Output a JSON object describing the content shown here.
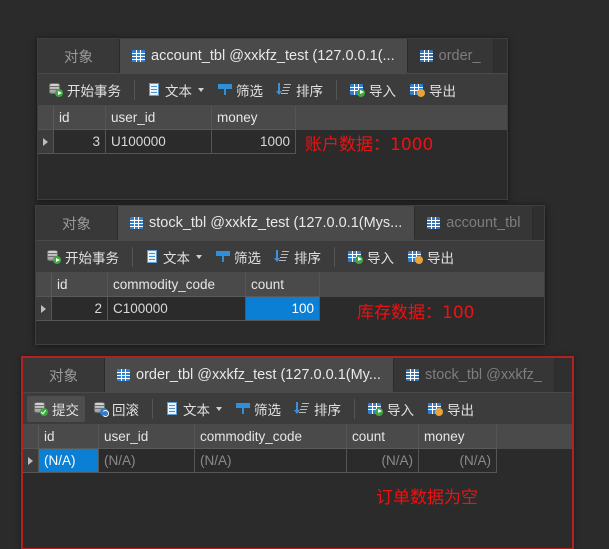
{
  "app": {
    "background_color": "#2b2b2b",
    "accent_color": "#0b7fd4",
    "annotation_color": "#ee1111",
    "highlight_border_color": "#b52020"
  },
  "panels": [
    {
      "id": "account-panel",
      "tabs": [
        {
          "label": "对象",
          "icon": "",
          "state": "object"
        },
        {
          "label": "account_tbl @xxkfz_test (127.0.0.1(...",
          "icon": "table-icon",
          "state": "active"
        },
        {
          "label": "order_",
          "icon": "table-icon",
          "state": "inactive"
        }
      ],
      "toolbar": [
        {
          "label": "开始事务",
          "icon": "begin-transaction-icon"
        },
        {
          "label": "文本",
          "icon": "text-icon",
          "caret": true
        },
        {
          "label": "筛选",
          "icon": "filter-icon"
        },
        {
          "label": "排序",
          "icon": "sort-icon"
        },
        {
          "label": "导入",
          "icon": "import-icon"
        },
        {
          "label": "导出",
          "icon": "export-icon"
        }
      ],
      "grid": {
        "columns": [
          "id",
          "user_id",
          "money"
        ],
        "rows": [
          {
            "current": true,
            "cells": [
              "3",
              "U100000",
              "1000"
            ]
          }
        ]
      },
      "annotation": "账户数据：1000"
    },
    {
      "id": "stock-panel",
      "tabs": [
        {
          "label": "对象",
          "icon": "",
          "state": "object"
        },
        {
          "label": "stock_tbl @xxkfz_test (127.0.0.1(Mys...",
          "icon": "table-icon",
          "state": "active"
        },
        {
          "label": "account_tbl",
          "icon": "table-icon",
          "state": "inactive"
        }
      ],
      "toolbar": [
        {
          "label": "开始事务",
          "icon": "begin-transaction-icon"
        },
        {
          "label": "文本",
          "icon": "text-icon",
          "caret": true
        },
        {
          "label": "筛选",
          "icon": "filter-icon"
        },
        {
          "label": "排序",
          "icon": "sort-icon"
        },
        {
          "label": "导入",
          "icon": "import-icon"
        },
        {
          "label": "导出",
          "icon": "export-icon"
        }
      ],
      "grid": {
        "columns": [
          "id",
          "commodity_code",
          "count"
        ],
        "rows": [
          {
            "current": true,
            "cells": [
              "2",
              "C100000",
              "100"
            ],
            "selected_index": 2
          }
        ]
      },
      "annotation": "库存数据：100"
    },
    {
      "id": "order-panel",
      "highlighted": true,
      "tabs": [
        {
          "label": "对象",
          "icon": "",
          "state": "object"
        },
        {
          "label": "order_tbl @xxkfz_test (127.0.0.1(My...",
          "icon": "table-icon",
          "state": "active"
        },
        {
          "label": "stock_tbl @xxkfz_",
          "icon": "table-icon",
          "state": "inactive"
        }
      ],
      "toolbar": [
        {
          "label": "提交",
          "icon": "commit-icon"
        },
        {
          "label": "回滚",
          "icon": "rollback-icon"
        },
        {
          "label": "文本",
          "icon": "text-icon",
          "caret": true
        },
        {
          "label": "筛选",
          "icon": "filter-icon"
        },
        {
          "label": "排序",
          "icon": "sort-icon"
        },
        {
          "label": "导入",
          "icon": "import-icon"
        },
        {
          "label": "导出",
          "icon": "export-icon"
        }
      ],
      "grid": {
        "columns": [
          "id",
          "user_id",
          "commodity_code",
          "count",
          "money"
        ],
        "rows": [
          {
            "current": true,
            "cells": [
              "(N/A)",
              "(N/A)",
              "(N/A)",
              "(N/A)",
              "(N/A)"
            ],
            "selected_index": 0
          }
        ]
      },
      "annotation": "订单数据为空"
    }
  ]
}
